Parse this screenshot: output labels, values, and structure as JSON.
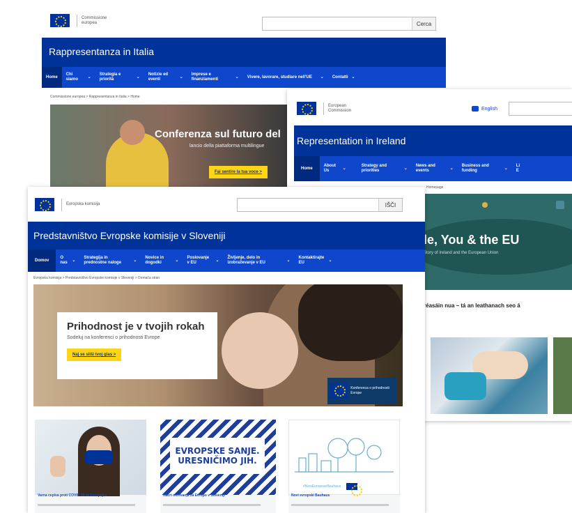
{
  "italy": {
    "logo_text": "Commissione europea",
    "search_button": "Cerca",
    "site_name": "Rappresentanza in Italia",
    "nav": [
      "Home",
      "Chi siamo",
      "Strategia e priorità",
      "Notizie ed eventi",
      "Imprese e finanziamenti",
      "Vivere, lavorare, studiare nell'UE",
      "Contatti"
    ],
    "breadcrumb": "Commissione europea  >  Rappresentanza in Italia  >  Home",
    "hero_title": "Conferenza sul futuro del",
    "hero_subtitle": "lancio della piattaforma multilingue",
    "hero_button": "Fai sentire la tua voce >"
  },
  "ireland": {
    "logo_text": "European Commission",
    "language": "English",
    "site_name": "Representation in Ireland",
    "nav": [
      "Home",
      "About Us",
      "Strategy and priorities",
      "News and events",
      "Business and funding",
      "Li E"
    ],
    "breadcrumb": "Homepage",
    "hero_title": "le, You & the EU",
    "hero_subtitle": "Story of Ireland and the European Union",
    "irish_text": "réasáin nua – tá an leathanach seo á"
  },
  "slovenia": {
    "logo_text": "Evropska komisija",
    "search_button": "IŠČI",
    "site_name": "Predstavništvo Evropske komisije v Sloveniji",
    "nav": [
      "Domov",
      "O nas",
      "Strategija in prednostne naloge",
      "Novice in dogodki",
      "Poslovanje v EU",
      "Življenje, delo in izobraževanje v EU",
      "Kontaktirajte EU"
    ],
    "breadcrumb": "Evropska komisija  >  Predstavništvo Evropske komisije v Sloveniji  >  Domača stran",
    "hero_title": "Prihodnost je v tvojih rokah",
    "hero_subtitle": "Sodeluj na konferenci o prihodnosti Evrope",
    "hero_button": "Naj se sliši tvoj glas >",
    "badge_text": "Konferenca o prihodnosti Evrope",
    "cards": [
      {
        "title": "Varna cepiva proti COVID-19 za Evropejce"
      },
      {
        "title": "Načrt okrevanja za Evropo v Sloveniji",
        "poster_line1": "EVROPSKE SANJE.",
        "poster_line2": "URESNIČIMO JIH."
      },
      {
        "title": "Novi evropski Bauhaus",
        "hashtag": "#NewEuropeanBauhaus"
      }
    ]
  },
  "colors": {
    "eu_blue": "#003399",
    "nav_blue": "#0e47cb",
    "eu_yellow": "#ffd617"
  }
}
